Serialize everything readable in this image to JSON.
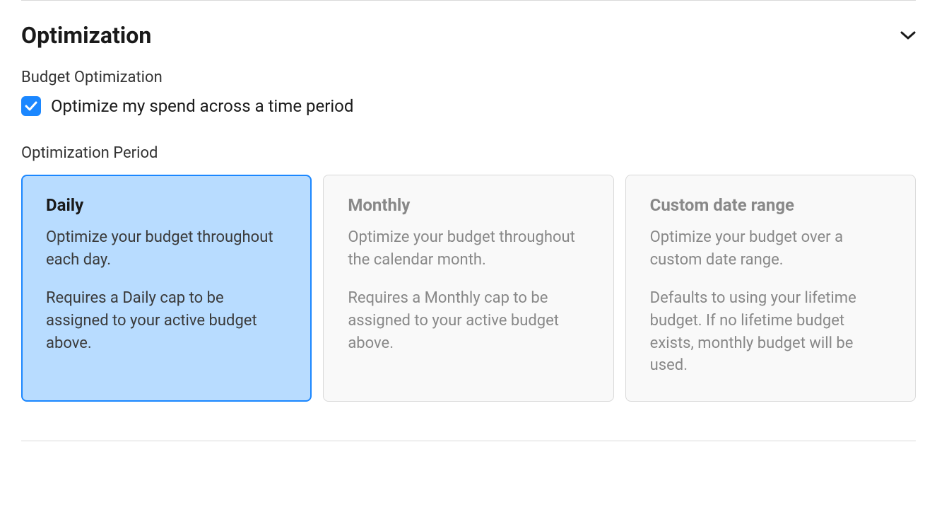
{
  "section": {
    "title": "Optimization"
  },
  "budget_optimization": {
    "label": "Budget Optimization",
    "checkbox_label": "Optimize my spend across a time period",
    "checked": true
  },
  "optimization_period": {
    "label": "Optimization Period",
    "selected": "daily",
    "options": [
      {
        "key": "daily",
        "title": "Daily",
        "desc": "Optimize your budget throughout each day.",
        "note": "Requires a Daily cap to be assigned to your active budget above."
      },
      {
        "key": "monthly",
        "title": "Monthly",
        "desc": "Optimize your budget throughout the calendar month.",
        "note": "Requires a Monthly cap to be assigned to your active budget above."
      },
      {
        "key": "custom",
        "title": "Custom date range",
        "desc": "Optimize your budget over a custom date range.",
        "note": "Defaults to using your lifetime budget. If no lifetime budget exists, monthly budget will be used."
      }
    ]
  }
}
